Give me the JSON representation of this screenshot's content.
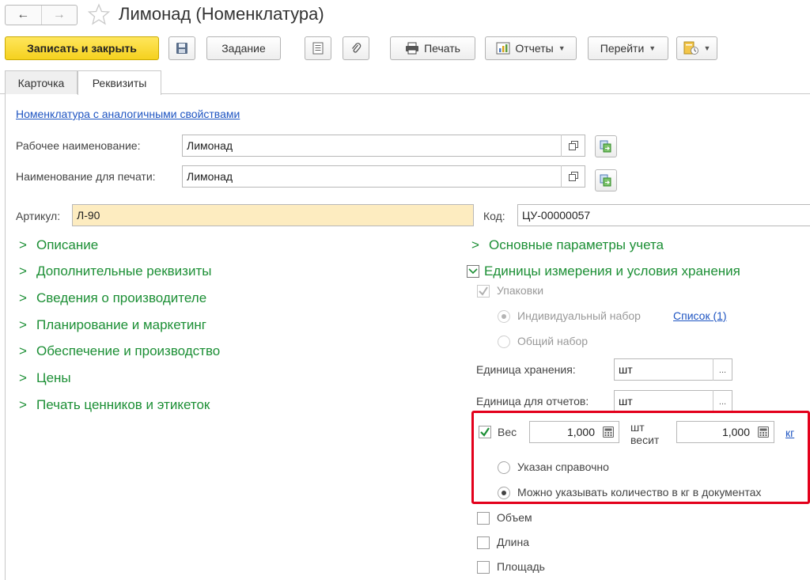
{
  "window": {
    "title": "Лимонад (Номенклатура)",
    "back_glyph": "←",
    "forward_glyph": "→"
  },
  "toolbar": {
    "save_close": "Записать и закрыть",
    "task": "Задание",
    "print": "Печать",
    "reports": "Отчеты",
    "goto": "Перейти"
  },
  "tabs": [
    {
      "label": "Карточка",
      "active": false
    },
    {
      "label": "Реквизиты",
      "active": true
    }
  ],
  "form": {
    "similar_link": "Номенклатура с аналогичными свойствами",
    "work_name_label": "Рабочее наименование:",
    "work_name_value": "Лимонад",
    "print_name_label": "Наименование для печати:",
    "print_name_value": "Лимонад",
    "article_label": "Артикул:",
    "article_value": "Л-90",
    "code_label": "Код:",
    "code_value": "ЦУ-00000057"
  },
  "left_groups": [
    "Описание",
    "Дополнительные реквизиты",
    "Сведения о производителе",
    "Планирование и маркетинг",
    "Обеспечение и производство",
    "Цены",
    "Печать ценников и этикеток"
  ],
  "right_groups": {
    "accounting": "Основные параметры учета",
    "units": "Единицы измерения и условия хранения"
  },
  "units": {
    "packages_label": "Упаковки",
    "packages_checked": true,
    "individual_set": "Индивидуальный набор",
    "list_link": "Список (1)",
    "common_set": "Общий набор",
    "storage_unit_label": "Единица хранения:",
    "storage_unit_value": "шт",
    "report_unit_label": "Единица для отчетов:",
    "report_unit_value": "шт",
    "select_glyph": "..."
  },
  "weight": {
    "label": "Вес",
    "checked": true,
    "qty_value": "1,000",
    "unit_line1": "шт",
    "unit_line2": "весит",
    "weight_value": "1,000",
    "weight_unit_link": "кг",
    "option_reference": "Указан справочно",
    "option_documents": "Можно указывать количество в кг в документах",
    "selected_option": "documents"
  },
  "other_checks": {
    "volume": "Объем",
    "length": "Длина",
    "area": "Площадь"
  },
  "colors": {
    "primary_button": "#f5d11e",
    "group_green": "#1c8f35",
    "link_blue": "#1f55c2",
    "highlight_red": "#e3001b",
    "article_field": "#fdecc0"
  }
}
